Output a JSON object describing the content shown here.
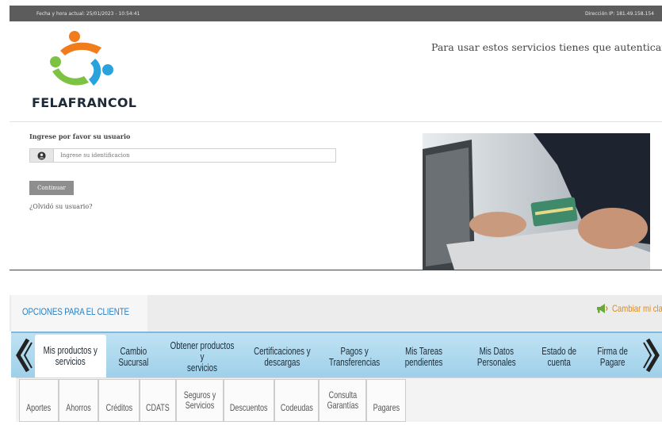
{
  "header": {
    "datetime": "Fecha y hora actual: 25/01/2023 - 10:54:41",
    "ip": "Dirección IP: 181.49.158.154"
  },
  "brand": {
    "name": "FELAFRANCOL"
  },
  "auth_message": "Para usar estos servicios tienes que autenticarte.",
  "login": {
    "label": "Ingrese por favor su usuario",
    "placeholder": "Ingrese su identificacion",
    "continue": "Continuar",
    "forgot": "¿Olvidó su usuario?"
  },
  "options": {
    "title": "OPCIONES PARA EL CLIENTE",
    "change_password": "Cambiar mi clave",
    "nav": [
      "Mis productos y\nservicios",
      "Cambio\nSucursal",
      "Obtener productos y\nservicios",
      "Certificaciones y\ndescargas",
      "Pagos y\nTransferencias",
      "Mis Tareas\npendientes",
      "Mis Datos\nPersonales",
      "Estado de\ncuenta",
      "Firma de\nPagare"
    ],
    "sub": [
      "Aportes",
      "Ahorros",
      "Créditos",
      "CDATS",
      "Seguros y\nServicios",
      "Descuentos",
      "Codeudas",
      "Consulta\nGarantías",
      "Pagares"
    ]
  },
  "colors": {
    "topbar": "#5c5c5c",
    "brand_orange": "#f07c1c",
    "brand_blue": "#2aa3dc",
    "brand_green": "#7dc242",
    "options_title": "#2a7fc0",
    "nav_bg": "#a9d6ee",
    "change_pw": "#e08a16"
  }
}
